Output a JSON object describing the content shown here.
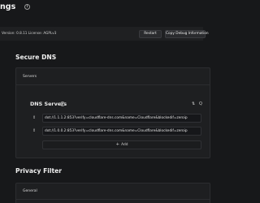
{
  "header": {
    "title": "ngs",
    "version_text": "Version: 0.8.11  License: AGPLv3",
    "restart_label": "Restart",
    "debug_label": "Copy Debug Information"
  },
  "secure_dns": {
    "title": "Secure DNS",
    "servers_label": "Servers",
    "dns_servers_title": "DNS Servers",
    "sort_label": "Q",
    "servers": [
      "dot://1.1.1.2:853?verify=cloudflare-dns.com&name=Cloudflare&blockedif=zeroip",
      "dot://1.0.0.2:853?verify=cloudflare-dns.com&name=Cloudflare&blockedif=zeroip"
    ],
    "add_label": "Add"
  },
  "privacy_filter": {
    "title": "Privacy Filter",
    "general_label": "General"
  }
}
